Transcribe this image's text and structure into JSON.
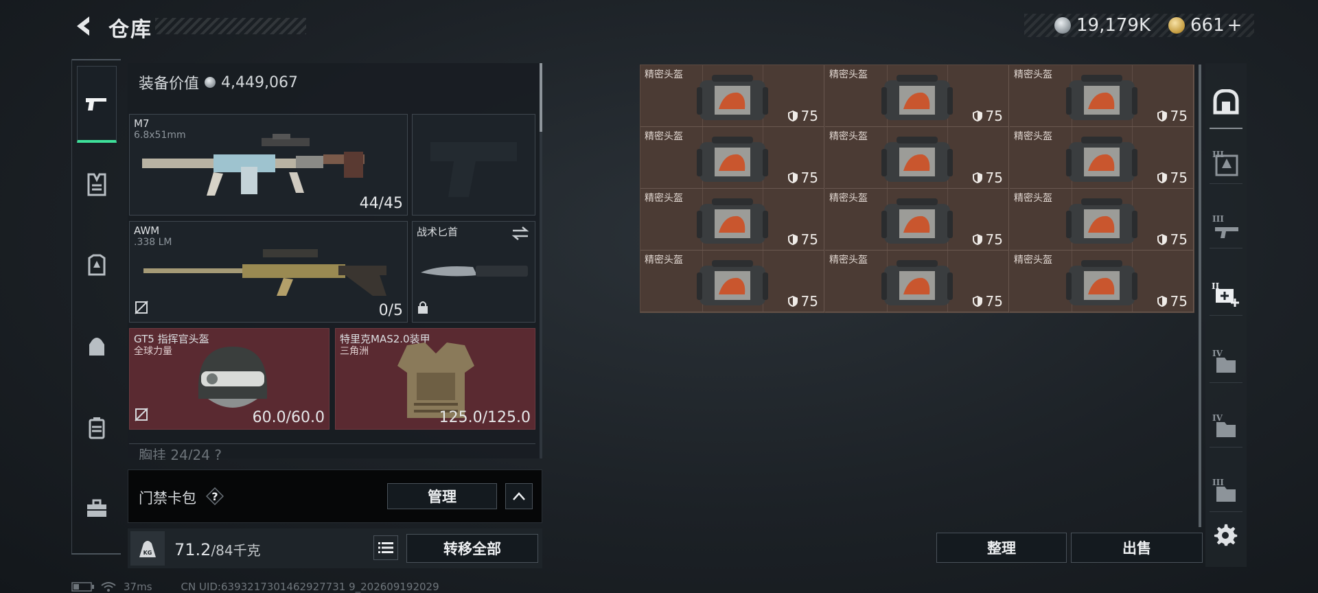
{
  "header": {
    "title": "仓库",
    "currency_silver": "19,179K",
    "currency_gold": "661",
    "currency_add": "+"
  },
  "left_panel": {
    "equip_value_label": "装备价值",
    "equip_value": "4,449,067",
    "slots": {
      "primary1": {
        "name": "M7",
        "ammo": "6.8x51mm",
        "count": "44/45"
      },
      "primary2": {
        "name": "AWM",
        "ammo": ".338 LM",
        "count": "0/5"
      },
      "melee": {
        "name": "战术匕首"
      },
      "helmet": {
        "name": "GT5 指挥官头盔",
        "sub": "全球力量",
        "durability": "60.0/60.0"
      },
      "armor": {
        "name": "特里克MAS2.0装甲",
        "sub": "三角洲",
        "durability": "125.0/125.0"
      }
    },
    "next_section": "胸挂  24/24  ?"
  },
  "card_pack": {
    "label": "门禁卡包",
    "help": "?",
    "manage_button": "管理"
  },
  "weight": {
    "current": "71.2",
    "max": "/84千克",
    "transfer_all_button": "转移全部"
  },
  "grid": {
    "item_name": "精密头盔",
    "items": [
      {
        "name": "精密头盔",
        "level": "75"
      },
      {
        "name": "精密头盔",
        "level": "75"
      },
      {
        "name": "精密头盔",
        "level": "75"
      },
      {
        "name": "精密头盔",
        "level": "75"
      },
      {
        "name": "精密头盔",
        "level": "75"
      },
      {
        "name": "精密头盔",
        "level": "75"
      },
      {
        "name": "精密头盔",
        "level": "75"
      },
      {
        "name": "精密头盔",
        "level": "75"
      },
      {
        "name": "精密头盔",
        "level": "75"
      },
      {
        "name": "精密头盔",
        "level": "75"
      },
      {
        "name": "精密头盔",
        "level": "75"
      },
      {
        "name": "精密头盔",
        "level": "75"
      }
    ]
  },
  "actions": {
    "organize_button": "整理",
    "sell_button": "出售"
  },
  "status": {
    "ping": "37ms",
    "uid": "CN UID:6393217301462927731 9_202609192029"
  },
  "colors": {
    "accent_green": "#3ee19a",
    "slot_red": "#5a2a31",
    "grid_brown": "#4b3b34"
  }
}
